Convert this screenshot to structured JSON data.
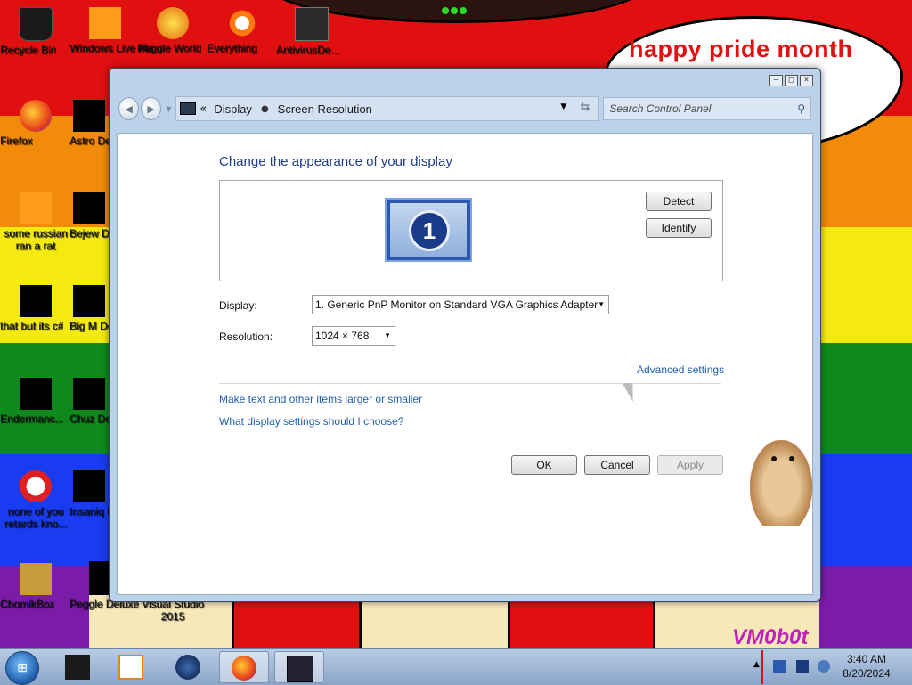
{
  "wallpaper": {
    "bubble_text": "happy pride month",
    "watermark": "VM0b0t"
  },
  "desktop_icons": [
    {
      "label": "Recycle Bin",
      "icon": "recycle-bin-icon"
    },
    {
      "label": "Windows Live Ma",
      "icon": "windows-live-icon"
    },
    {
      "label": "Peggle World",
      "icon": "peggle-icon"
    },
    {
      "label": "Everything",
      "icon": "everything-icon"
    },
    {
      "label": "AntivirusDe...",
      "icon": "antivirus-icon"
    },
    {
      "label": "Firefox",
      "icon": "firefox-icon"
    },
    {
      "label": "Astro Delu",
      "icon": "game-icon"
    },
    {
      "label": "some russian ran a rat",
      "icon": "file-icon"
    },
    {
      "label": "Bejew Delu",
      "icon": "game-icon"
    },
    {
      "label": "that but its c#",
      "icon": "file-icon"
    },
    {
      "label": "Big M Delu",
      "icon": "game-icon"
    },
    {
      "label": "Endermanc...",
      "icon": "app-icon"
    },
    {
      "label": "Chuz Delu",
      "icon": "game-icon"
    },
    {
      "label": "none of you retards kno...",
      "icon": "file-icon"
    },
    {
      "label": "Insaniq Delu",
      "icon": "game-icon"
    },
    {
      "label": "ChomikBox",
      "icon": "chomikbox-icon"
    },
    {
      "label": "Peggle Deluxe",
      "icon": "peggle-icon"
    },
    {
      "label": "Visual Studio 2015",
      "icon": "visual-studio-icon"
    }
  ],
  "window": {
    "breadcrumb": [
      "Display",
      "Screen Resolution"
    ],
    "search_placeholder": "Search Control Panel",
    "heading": "Change the appearance of your display",
    "monitor_number": "1",
    "detect_label": "Detect",
    "identify_label": "Identify",
    "display_label": "Display:",
    "display_value": "1. Generic PnP Monitor on Standard VGA Graphics Adapter",
    "resolution_label": "Resolution:",
    "resolution_value": "1024 × 768",
    "advanced_link": "Advanced settings",
    "link_text_size": "Make text and other items larger or smaller",
    "link_display_help": "What display settings should I choose?",
    "ok_label": "OK",
    "cancel_label": "Cancel",
    "apply_label": "Apply"
  },
  "taskbar": {
    "time": "3:40 AM",
    "date": "8/20/2024"
  }
}
